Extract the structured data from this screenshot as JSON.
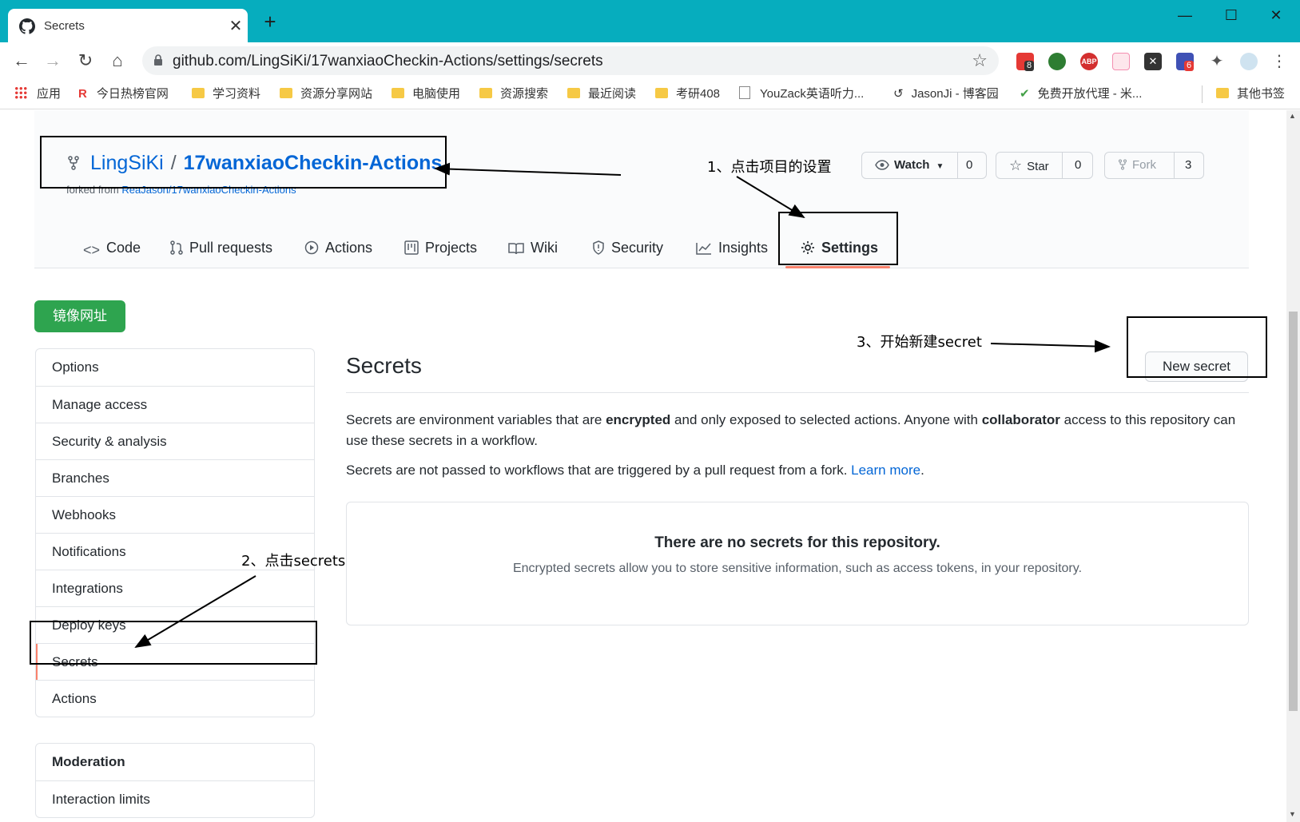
{
  "browser": {
    "tab_title": "Secrets",
    "new_tab": "+",
    "url": "github.com/LingSiKi/17wanxiaoCheckin-Actions/settings/secrets",
    "ext_badges": [
      "8",
      "6"
    ],
    "ext_abp": "ABP",
    "bookmarks": [
      "应用",
      "今日热榜官网",
      "学习资料",
      "资源分享网站",
      "电脑使用",
      "资源搜索",
      "最近阅读",
      "考研408",
      "YouZack英语听力...",
      "JasonJi - 博客园",
      "免费开放代理 - 米...",
      "其他书签"
    ]
  },
  "repo": {
    "owner": "LingSiKi",
    "separator": "/",
    "name": "17wanxiaoCheckin-Actions",
    "forked_prefix": "forked from ",
    "forked_link": "ReaJason/17wanxiaoCheckin-Actions",
    "watch_label": "Watch",
    "watch_count": "0",
    "star_label": "Star",
    "star_count": "0",
    "fork_label": "Fork",
    "fork_count": "3"
  },
  "tabs": [
    "Code",
    "Pull requests",
    "Actions",
    "Projects",
    "Wiki",
    "Security",
    "Insights",
    "Settings"
  ],
  "mirror_button": "镜像网址",
  "sidebar": {
    "items": [
      "Options",
      "Manage access",
      "Security & analysis",
      "Branches",
      "Webhooks",
      "Notifications",
      "Integrations",
      "Deploy keys",
      "Secrets",
      "Actions"
    ],
    "moderation_header": "Moderation",
    "moderation_items": [
      "Interaction limits"
    ]
  },
  "main": {
    "title": "Secrets",
    "new_secret": "New secret",
    "p1_a": "Secrets are environment variables that are ",
    "p1_b": "encrypted",
    "p1_c": " and only exposed to selected actions. Anyone with ",
    "p1_d": "collaborator",
    "p1_e": " access to this repository can use these secrets in a workflow.",
    "p2_a": "Secrets are not passed to workflows that are triggered by a pull request from a fork. ",
    "p2_link": "Learn more",
    "p2_end": ".",
    "empty_title": "There are no secrets for this repository.",
    "empty_desc": "Encrypted secrets allow you to store sensitive information, such as access tokens, in your repository."
  },
  "annotations": {
    "step1": "1、点击项目的设置",
    "step2": "2、点击secrets",
    "step3": "3、开始新建secret"
  }
}
